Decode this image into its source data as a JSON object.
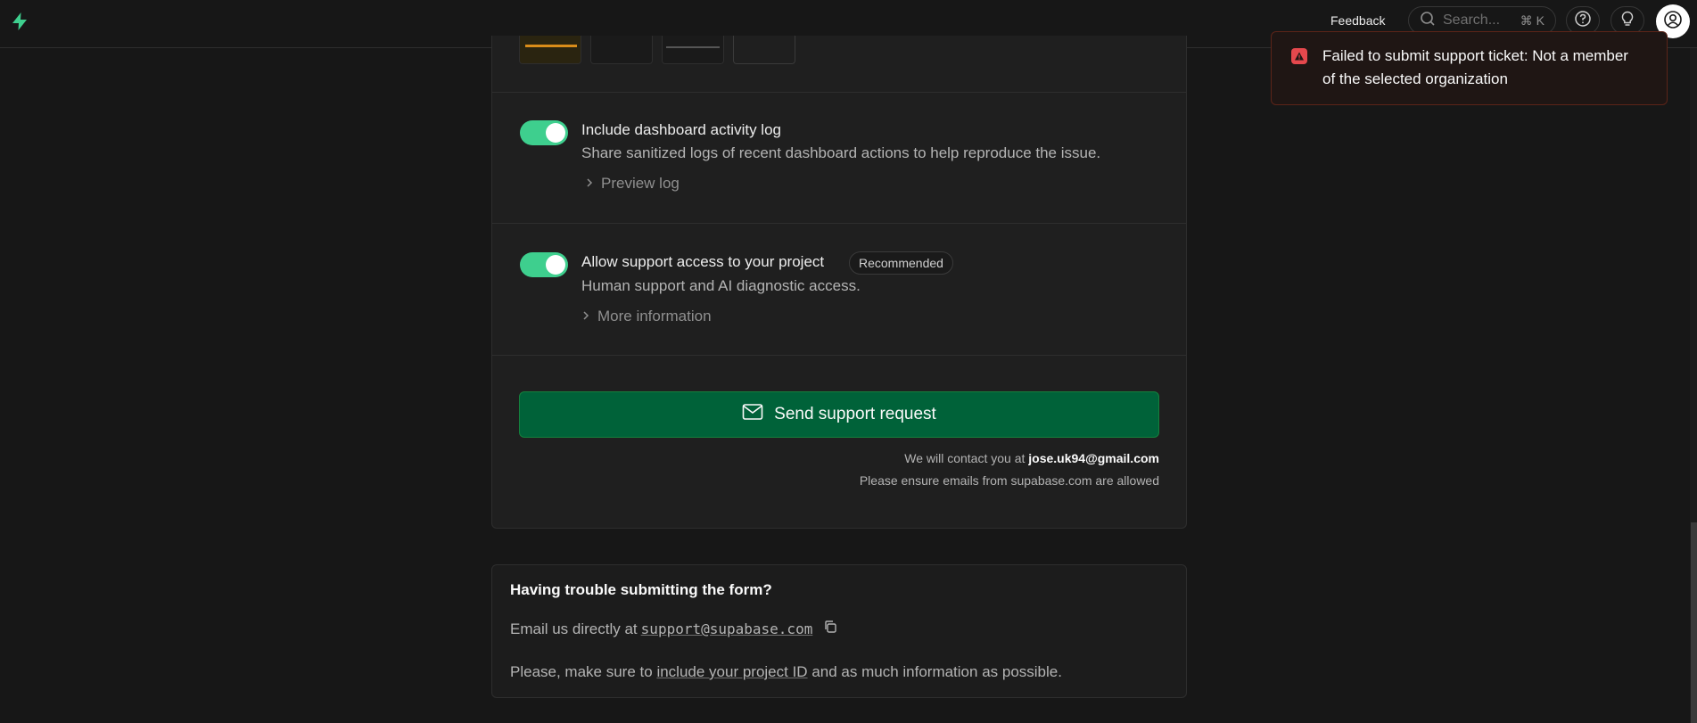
{
  "topbar": {
    "feedback_label": "Feedback",
    "search_placeholder": "Search...",
    "search_shortcut": "⌘ K"
  },
  "attachments": {
    "thumbnails": 4
  },
  "options": {
    "activity_log": {
      "enabled": true,
      "title": "Include dashboard activity log",
      "description": "Share sanitized logs of recent dashboard actions to help reproduce the issue.",
      "link": "Preview log"
    },
    "support_access": {
      "enabled": true,
      "title": "Allow support access to your project",
      "badge": "Recommended",
      "description": "Human support and AI diagnostic access.",
      "link": "More information"
    }
  },
  "submit": {
    "button_label": "Send support request",
    "contact_prefix": "We will contact you at",
    "contact_email": "jose.uk94@gmail.com",
    "ensure_note": "Please ensure emails from supabase.com are allowed"
  },
  "help": {
    "title": "Having trouble submitting the form?",
    "email_prefix": "Email us directly at",
    "email": "support@supabase.com",
    "line2_prefix": "Please, make sure to",
    "line2_link": "include your project ID",
    "line2_suffix": "and as much information as possible."
  },
  "toast": {
    "message": "Failed to submit support ticket: Not a member of the selected organization"
  },
  "colors": {
    "accent": "#3ecf8e",
    "button": "#006239",
    "error": "#e5484d"
  }
}
